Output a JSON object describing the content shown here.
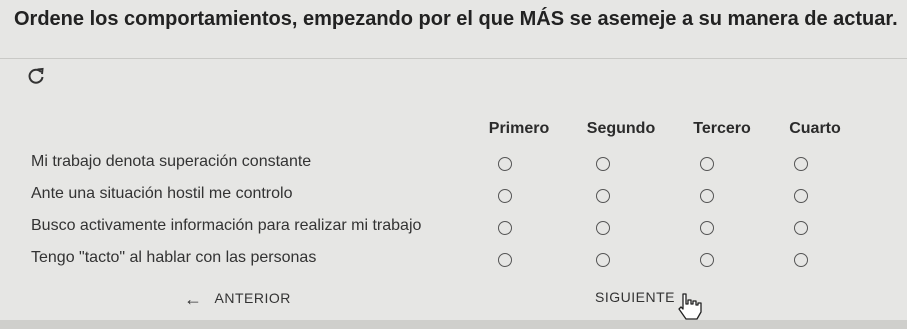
{
  "question": "Ordene los comportamientos, empezando por el que MÁS se asemeje a su manera de actuar.",
  "reload_icon": "reload-icon",
  "columns": [
    "Primero",
    "Segundo",
    "Tercero",
    "Cuarto"
  ],
  "rows": [
    "Mi trabajo denota superación constante",
    "Ante una situación hostil me controlo",
    "Busco activamente información para realizar mi trabajo",
    "Tengo \"tacto\" al hablar con las personas"
  ],
  "nav": {
    "previous": "ANTERIOR",
    "next": "SIGUIENTE"
  }
}
